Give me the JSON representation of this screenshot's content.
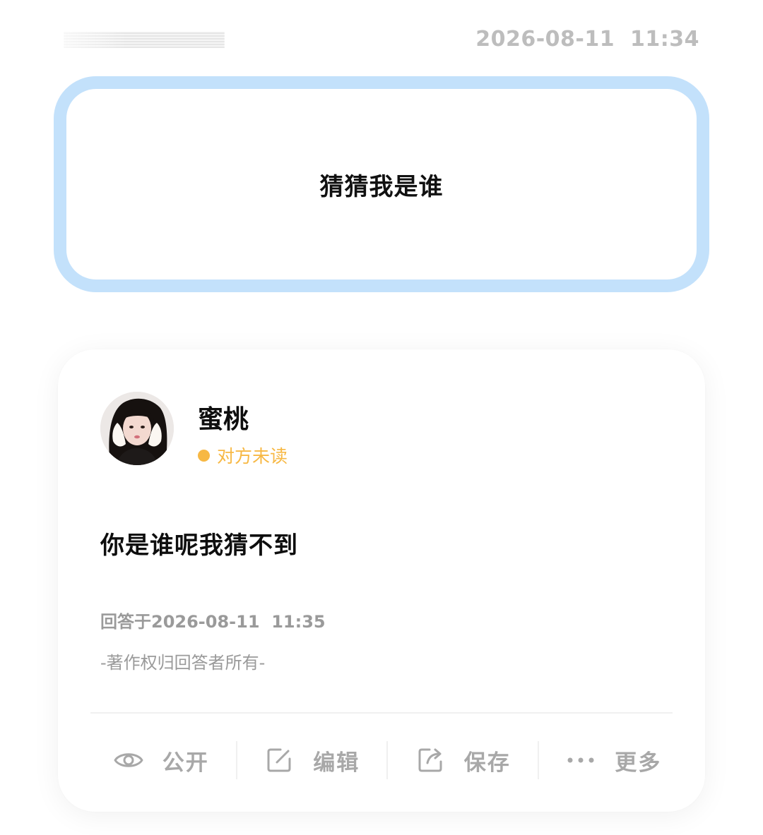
{
  "header": {
    "timestamp": "2026-08-11  11:34"
  },
  "question": {
    "text": "猜猜我是谁",
    "border_color": "#c3e1fb"
  },
  "answer": {
    "user": {
      "name": "蜜桃",
      "status": "对方未读",
      "status_color": "#f7b844"
    },
    "text": "你是谁呢我猜不到",
    "answered_at": "回答于2026-08-11  11:35",
    "copyright": "-著作权归回答者所有-",
    "actions": [
      {
        "icon": "eye-icon",
        "label": "公开"
      },
      {
        "icon": "edit-icon",
        "label": "编辑"
      },
      {
        "icon": "share-icon",
        "label": "保存"
      },
      {
        "icon": "more-dots-icon",
        "label": "更多"
      }
    ]
  }
}
